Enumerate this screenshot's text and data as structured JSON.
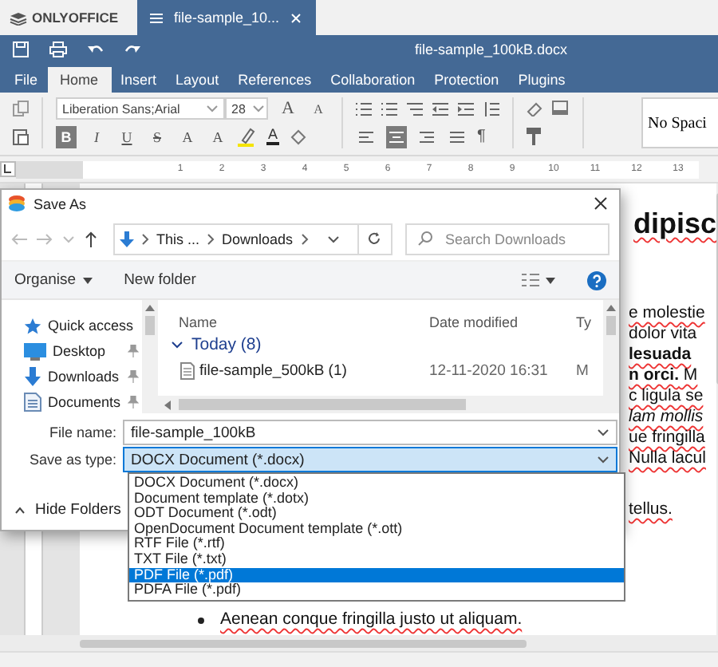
{
  "app": {
    "brand": "ONLYOFFICE",
    "document_tab": "file-sample_10..."
  },
  "title": "file-sample_100kB.docx",
  "menu": [
    {
      "label": "File",
      "selected": false
    },
    {
      "label": "Home",
      "selected": true
    },
    {
      "label": "Insert",
      "selected": false
    },
    {
      "label": "Layout",
      "selected": false
    },
    {
      "label": "References",
      "selected": false
    },
    {
      "label": "Collaboration",
      "selected": false
    },
    {
      "label": "Protection",
      "selected": false
    },
    {
      "label": "Plugins",
      "selected": false
    }
  ],
  "toolbar": {
    "font": "Liberation Sans;Arial",
    "size": "28",
    "size_buttons": [
      {
        "glyph": "A",
        "kind": "grow"
      },
      {
        "glyph": "A",
        "kind": "shrink"
      }
    ],
    "format_buttons": [
      {
        "glyph": "B",
        "kind": "bold",
        "selected": true
      },
      {
        "glyph": "I",
        "kind": "italic",
        "selected": false
      },
      {
        "glyph": "U",
        "kind": "underline",
        "selected": false
      },
      {
        "glyph": "S",
        "kind": "strike",
        "selected": false
      },
      {
        "glyph": "A",
        "kind": "superscript",
        "selected": false
      },
      {
        "glyph": "A",
        "kind": "subscript",
        "selected": false
      }
    ],
    "font_color_glyph": "A",
    "align_buttons": [
      {
        "kind": "left",
        "selected": false
      },
      {
        "kind": "center",
        "selected": true
      },
      {
        "kind": "right",
        "selected": false
      },
      {
        "kind": "justify",
        "selected": false
      }
    ],
    "pilcrow": "¶",
    "style_preview": "No Spaci"
  },
  "ruler": [
    "1",
    "2",
    "3",
    "4",
    "5",
    "6",
    "7",
    "8",
    "9",
    "10",
    "11",
    "12",
    "13"
  ],
  "document": [
    {
      "kind": "heading",
      "lines": [
        {
          "text": "dipisc",
          "kind": "plain",
          "misspelled": true
        }
      ]
    },
    {
      "kind": "body",
      "lines": [
        {
          "text": "e molestie",
          "kind": "plain",
          "misspelled": true
        },
        {
          "text": "dolor vita",
          "kind": "plain",
          "misspelled": false
        },
        {
          "text": "lesuada",
          "kind": "bold",
          "misspelled": true
        },
        {
          "text": "**n orci.** M",
          "kind": "plain",
          "misspelled": true
        },
        {
          "text": "c ligula se",
          "kind": "plain",
          "misspelled": true
        },
        {
          "text": "lam mollis",
          "kind": "italic",
          "misspelled": true
        },
        {
          "text": "ue fringilla",
          "kind": "plain",
          "misspelled": true
        },
        {
          "text": "Nulla lacul",
          "kind": "plain",
          "misspelled": true
        }
      ]
    },
    {
      "kind": "body",
      "lines": [
        {
          "text": "tellus.",
          "kind": "plain",
          "misspelled": true
        }
      ]
    },
    {
      "kind": "bullet",
      "lines": [
        {
          "text": "Aenean conque fringilla justo ut aliquam.",
          "kind": "plain",
          "misspelled": true
        }
      ]
    }
  ],
  "dialog": {
    "title": "Save As",
    "path": [
      "This ...",
      "Downloads"
    ],
    "search_placeholder": "Search Downloads",
    "commands": [
      {
        "label": "Organise",
        "kind": "menu"
      },
      {
        "label": "New folder",
        "kind": "plain"
      }
    ],
    "nav": [
      {
        "label": "Quick access",
        "kind": "quick",
        "pinned": false
      },
      {
        "label": "Desktop",
        "kind": "desktop",
        "pinned": true
      },
      {
        "label": "Downloads",
        "kind": "downloads",
        "pinned": true
      },
      {
        "label": "Documents",
        "kind": "documents",
        "pinned": true
      }
    ],
    "columns": [
      "Name",
      "Date modified",
      "Ty"
    ],
    "group": "Today (8)",
    "files": [
      {
        "name": "file-sample_500kB (1)",
        "date": "12-11-2020 16:31",
        "column_3": "M"
      }
    ],
    "fields": [
      {
        "label": "File name:",
        "value": "file-sample_100kB",
        "focused": false
      },
      {
        "label": "Save as type:",
        "value": "DOCX Document (*.docx)",
        "focused": true
      }
    ],
    "hide_folders": "Hide Folders",
    "type_options": [
      {
        "label": "DOCX Document (*.docx)",
        "selected": false
      },
      {
        "label": "Document template (*.dotx)",
        "selected": false
      },
      {
        "label": "ODT Document (*.odt)",
        "selected": false
      },
      {
        "label": "OpenDocument Document template (*.ott)",
        "selected": false
      },
      {
        "label": "RTF File (*.rtf)",
        "selected": false
      },
      {
        "label": "TXT File (*.txt)",
        "selected": false
      },
      {
        "label": "PDF File (*.pdf)",
        "selected": true
      },
      {
        "label": "PDFA File (*.pdf)",
        "selected": false
      }
    ]
  }
}
